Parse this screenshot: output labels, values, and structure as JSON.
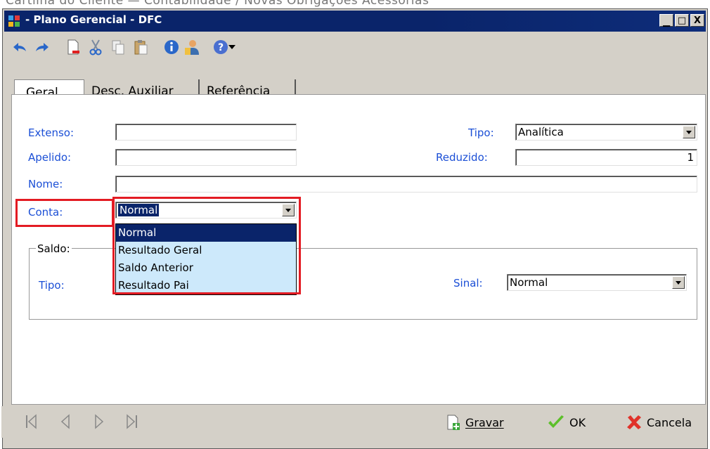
{
  "doc_header": "Cartilha do Cliente — Contabilidade / Novas Obrigações Acessórias",
  "window": {
    "title": "- Plano Gerencial - DFC",
    "controls": {
      "minimize": "_",
      "maximize": "□",
      "close": "X"
    }
  },
  "toolbar": {
    "icons": [
      "undo-icon",
      "redo-icon",
      "new-document-icon",
      "cut-icon",
      "copy-icon",
      "paste-icon",
      "info-icon",
      "user-icon",
      "help-icon",
      "dropdown-arrow-icon"
    ]
  },
  "tabs": [
    {
      "label": "Geral",
      "active": true
    },
    {
      "label": "Desc. Auxiliar",
      "active": false
    },
    {
      "label": "Referência",
      "active": false
    }
  ],
  "form": {
    "extenso_label": "Extenso:",
    "extenso_value": "",
    "apelido_label": "Apelido:",
    "apelido_value": "",
    "nome_label": "Nome:",
    "nome_value": "",
    "conta_label": "Conta:",
    "conta_value": "Normal",
    "tipo_label": "Tipo:",
    "tipo_value": "Analítica",
    "reduzido_label": "Reduzido:",
    "reduzido_value": "1"
  },
  "saldo": {
    "caption": "Saldo:",
    "tipo_label": "Tipo:",
    "sinal_label": "Sinal:",
    "sinal_value": "Normal"
  },
  "conta_dropdown": {
    "options": [
      "Normal",
      "Resultado Geral",
      "Saldo Anterior",
      "Resultado Pai"
    ],
    "selected": "Normal"
  },
  "footer": {
    "gravar_label": "Gravar",
    "ok_label": "OK",
    "cancela_label": "Cancela"
  },
  "colors": {
    "label_blue": "#1b4fd6",
    "highlight_red": "#e31b23",
    "selection_navy": "#0a246a",
    "dropdown_bg": "#cde9fb"
  }
}
